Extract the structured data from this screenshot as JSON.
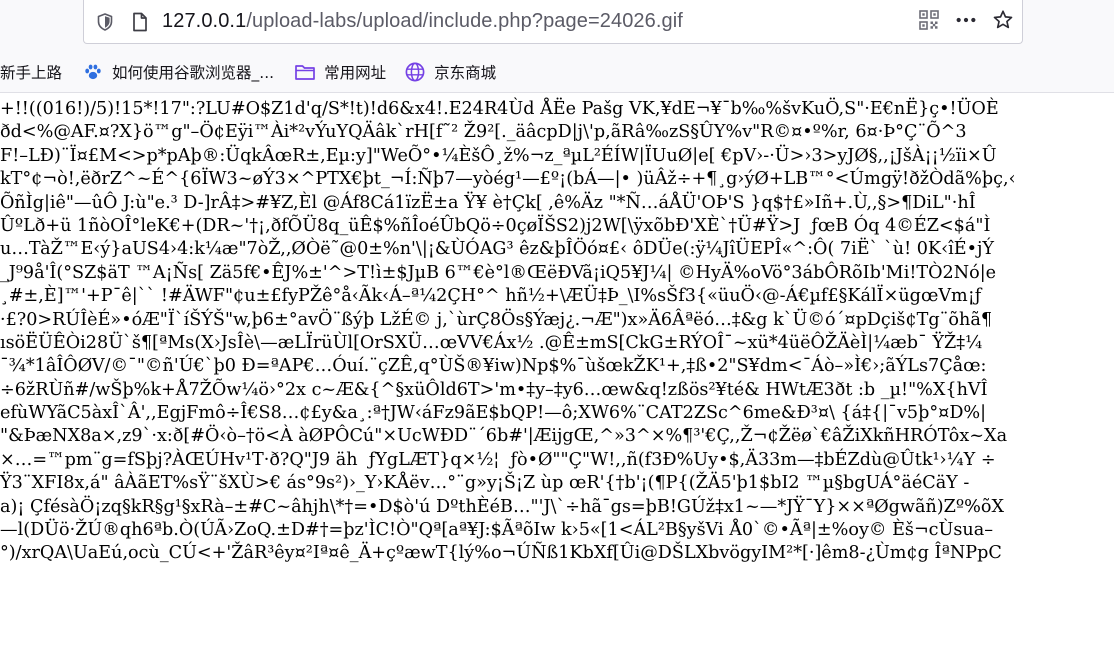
{
  "browser": {
    "url_host": "127.0.0.1",
    "url_rest": "/upload-labs/upload/include.php?page=24026.gif",
    "icons": {
      "left": [
        "shield-icon",
        "page-icon"
      ],
      "right": [
        "qr-code-icon",
        "more-icon",
        "star-icon"
      ]
    }
  },
  "bookmarks": [
    {
      "label": "新手上路",
      "icon": ""
    },
    {
      "label": "如何使用谷歌浏览器_...",
      "icon": "paw-icon"
    },
    {
      "label": "常用网址",
      "icon": "folder-icon"
    },
    {
      "label": "京东商城",
      "icon": "globe-icon"
    }
  ],
  "content": {
    "lines": [
      "+!!((016!)/5)!15*!17\":?LU#O$Z1d'q/S*!t)!d6&x4!.E24R4Ùd ÅËe Pašg VK,¥dE¬¥¯b‰%švKuÖ,S\"·E€nË}ç•!ÜOÈ",
      "ðd<%@AF.¤?X}ö™g\"–Ö¢Eÿi™Ài*²vÝuYQÄâk`rH[f˜² Ž9²[._äâcpD|j\\'p,ãRâ‰zS§ÛY%v\"R©¤•º%r, 6¤·Þ°Ç¨Õ^3",
      "F!–LÐ)¨Ï¤£M<>p*pAþ®:ÜqkÂœR±,Eµ:y]\"WeÕ°•¼ÈšÔ¸ž%¬z_ªµL²ÉÍW|ÏUuØ|e[ €pV›-·Ü>›3>yJØ§,,¡JšÀ¡¡½ïi×Û",
      "kT°¢¬ò!,ëðrZ^~É^{6ÏW3~øÝ3×^PTX€þt_¬Í:Ñþ7—yòég¹—£º¡(bÁ—|• )üÂž÷+¶¸g›ýØ+LB™°<Úmgÿ!ðžÒdã%þç,‹",
      "ÕñÌg|iê\"—ûÔ J:ù\"e.³ D-]rÂ‡>#¥Z,Èl @Áf8Cá1ïzË±a Ÿ¥ è†Çk[ ,ê%Äz \"*Ñ…áÅÜ'OÞ'S }q$†£»Iñ+.Ù,,§>¶DiL\"·hÎ",
      "Ûº‍Lð+ü 1ñòOÎ°leK€+(DR~'†¡,ðfÕÜ8q_üÊ$%ñÎoéÛbQö÷0çøÏŠS2)j2W[\\ÿxõbÐ'XÈ`†Ü#Ÿ>J  ƒœB Óq 4©ÉZ<$á\"Ì",
      "u…TàŽ™E‹ý}aUS4›4:k¼æ\"7òŽ,,ØÒë˜@0±%n'\\|¡&ÙÓAG³ êz&þÎÖó¤£‹ ôDÜe(:ÿ¼JîÜEPÎ«^:Ô( 7iË` `ù! 0K‹îÉ•jÝ",
      "_J⁹9å'Î(°SZ$äT ™A¡Ñs[ Zä5f€•ÊJ%±'^>T!ì±$JµB 6™€è°l®ŒëÐVã¡iQ5¥J¼| ©HyÄ%oVö°3ábÔRõIb'Mi!TÒ2Nó|e",
      "¸#±,È]™'+P¯ê|`` !#ÄWF\"¢u±£fyPŽê°å‹Ãk‹Á–ª¼2ÇH°^ hñ½+\\ÆÜ‡Þ_\\I%sŠf3{«üuÖ‹@-Á€µf£§KálÏ×ügœVm¡ƒ",
      "·£?0>RÚÎèÉ»•óÆ\"Ï`íŠÝŠ\"w,þ6±°avÖ¨ßýþ LžÉ© j,`ùrÇ8Ös§Ýæj¿.¬Æ\")x»Ä6Âªëó…‡&g k`Ü©ó´¤pDçiš¢Tg¨õhã¶",
      "ısöËÜÊÒi28Ü`š¶[ªMs(X›JsÎè\\—æLÏrüÙl[OrSXÜ…œVV€Áx½ .@Ê±mS[CkG±RÝOÎ¯~xü*4üëÔŽÄèÌ|¼æb¯ ŸŽ‡¼",
      "¯¾*1âÎÔØV/©¯\"©ñ'Ú€`þ0 Ð=ªAP€…Óuí.¨çZÊ,q°ÙŠ®¥iw)Np$%¯ùšœkŽK¹+,‡ß•2\"S¥dm<¯Áò–»Ì€›;ãÝLs7Çåœ:",
      "÷6žRÙñ#/wŠþ%k+Å7ŽÕw¼ö›°2x c~Æ&{^§xüÔld6T>'m•‡y–‡y6…œw&q!zßös²¥té& HWtÆ3ðt :b _µ!\"%X{hVÎ",
      "efùWYãC5àxÎ`Â',,EgjFmô÷Î€S8…¢£y&a¸:ª†JW‹áFz9ãE$bQP!—ô;XW6%¨CAT2ZSc^6me&Ð³¤\\ {á‡{|¯v5þ°¤D%|",
      "\"&ÞæNX8a×,z9`·x:ð[#Ö‹ò–†ö<À àØPÔCú\"×UcWÐD¨´6b#'|ÆijgŒ,^»3^×%¶³'€Ç,,Ž¬¢Žëø`€âŽiXkñHRÓTôx~Xa",
      "×…=™pm¨g=fSþj?ÀŒÚHv¹T·ð?Q\"J9 äh  ƒYgLÆT}q×½¦  ƒò•Ø\"\"Ç\"W!,,ñ(f3Ð%Uy•$,Ä33m—‡bÉZdù@Ûtk¹›¼Y ÷",
      "Ÿ3¨XFI8x,á\" âÀãET%sŸ¨šXÙ>€ ás°9s²)›_Y›KÅëv…°¨g»y¡Š¡Z ùp œR'{†b'¡(¶P{(ŽÄ5'þ1$bI2 ™µ§bgUÁ°äéCäY -",
      "a)¡ ÇfésàÖ¡zq§kR§g¹§xRà–±#C~âhjh\\*†=•D$ò'ú DºthÈéB…\"'J\\`÷hã¯gs=þB!GÚž‡x1~—*JŸ¯Y}××ªØgwãñ)Zº%õX",
      "—l(DÜö·ŽÚ®qh6ªb.Ò(ÚÃ›ZoQ.±D#†=þz'ÌC!Ò\"Qª[aª¥J:$ÃªõIw k›5«[1<ÁL²B§yšVi Å0`©•Ãª|±%oy© Èš¬cÙsua–",
      "°)/xrQA\\UaEú,ocù_CÚ<+'ŽâR³êy¤²Iª¤ê_Ä+çºæwT{lý%o¬ÚÑß1KbXf[Ûi@DŠLXbvögyIM²*[·]êm8-¿Ùm¢g ÎªNPpC"
    ]
  }
}
